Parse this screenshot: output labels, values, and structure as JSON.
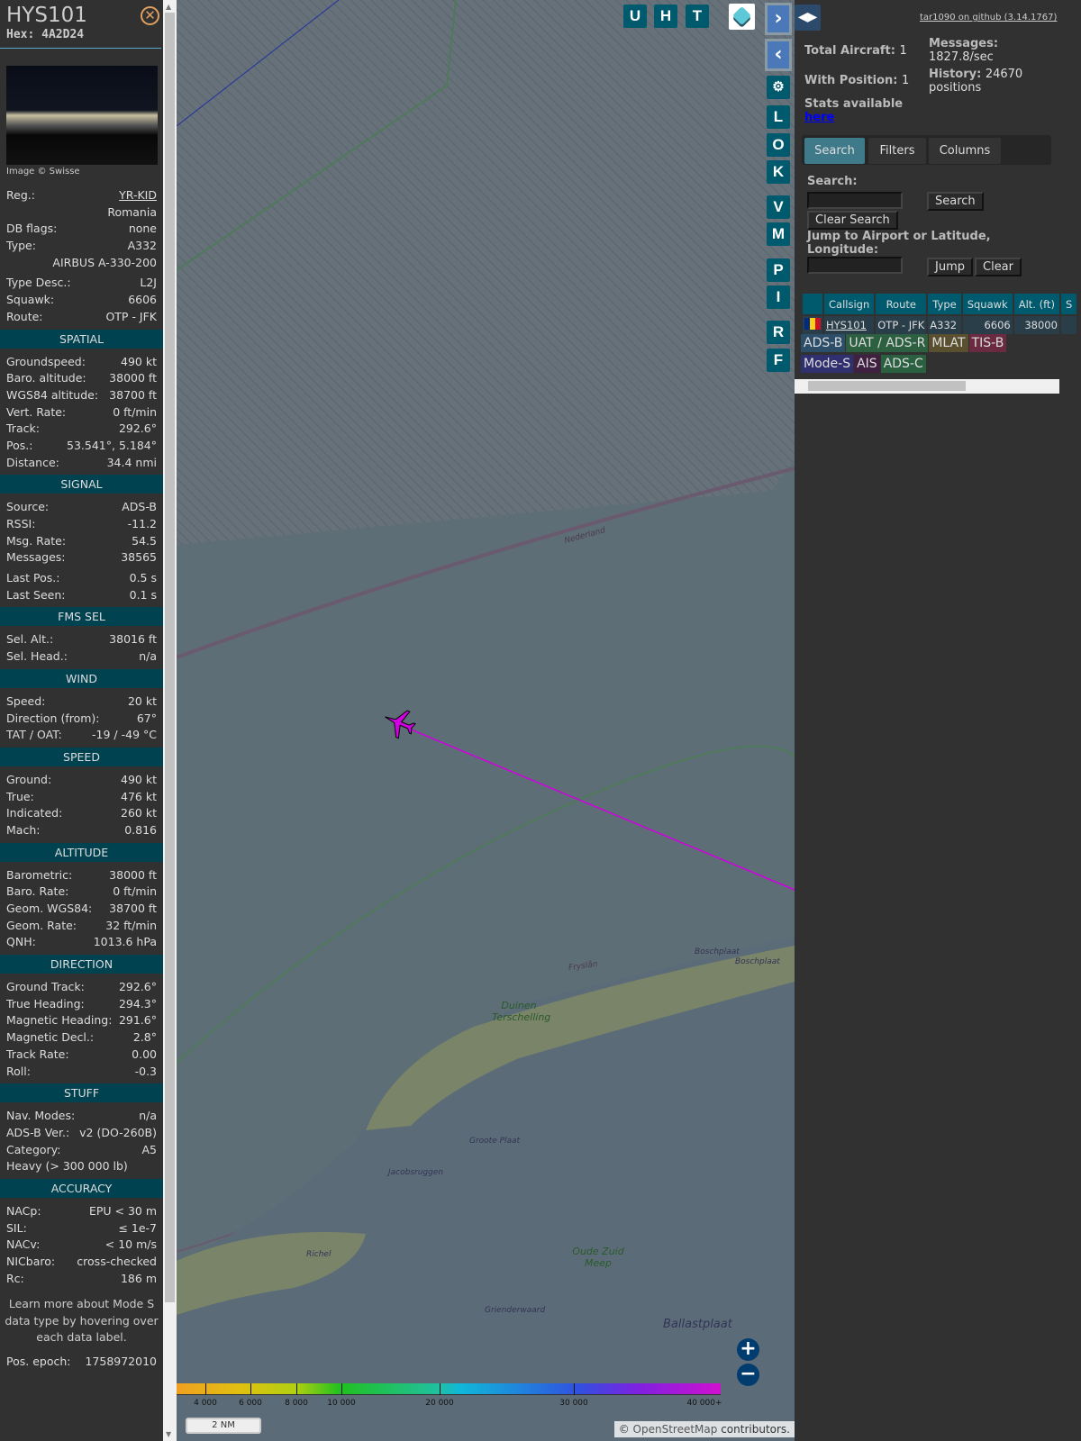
{
  "aircraft": {
    "callsign": "HYS101",
    "hex": "Hex: 4A2D24",
    "image_caption": "Image © Swisse"
  },
  "info_rows": [
    {
      "label": "Reg.:",
      "value": "YR-KID",
      "link": true
    },
    {
      "label": "",
      "value": "Romania"
    },
    {
      "label": "DB flags:",
      "value": "none"
    },
    {
      "label": "Type:",
      "value": "A332"
    },
    {
      "label": "",
      "value": "AIRBUS A-330-200"
    },
    {
      "label": "Type Desc.:",
      "value": "L2J",
      "gap": true
    },
    {
      "label": "Squawk:",
      "value": "6606"
    },
    {
      "label": "Route:",
      "value": "OTP - JFK"
    }
  ],
  "sections": [
    {
      "title": "SPATIAL",
      "rows": [
        [
          "Groundspeed:",
          "490 kt"
        ],
        [
          "Baro. altitude:",
          "38000 ft"
        ],
        [
          "WGS84 altitude:",
          "38700 ft"
        ],
        [
          "Vert. Rate:",
          "0 ft/min"
        ],
        [
          "Track:",
          "292.6°"
        ],
        [
          "Pos.:",
          "53.541°, 5.184°"
        ],
        [
          "Distance:",
          "34.4 nmi"
        ]
      ]
    },
    {
      "title": "SIGNAL",
      "rows": [
        [
          "Source:",
          "ADS-B"
        ],
        [
          "RSSI:",
          "-11.2"
        ],
        [
          "Msg. Rate:",
          "54.5"
        ],
        [
          "Messages:",
          "38565"
        ],
        [
          "Last Pos.:",
          "0.5 s",
          true
        ],
        [
          "Last Seen:",
          "0.1 s"
        ]
      ]
    },
    {
      "title": "FMS SEL",
      "rows": [
        [
          "Sel. Alt.:",
          "38016 ft"
        ],
        [
          "Sel. Head.:",
          "n/a"
        ]
      ]
    },
    {
      "title": "WIND",
      "rows": [
        [
          "Speed:",
          "20 kt"
        ],
        [
          "Direction (from):",
          "67°"
        ],
        [
          "TAT / OAT:",
          "-19 / -49 °C"
        ]
      ]
    },
    {
      "title": "SPEED",
      "rows": [
        [
          "Ground:",
          "490 kt"
        ],
        [
          "True:",
          "476 kt"
        ],
        [
          "Indicated:",
          "260 kt"
        ],
        [
          "Mach:",
          "0.816"
        ]
      ]
    },
    {
      "title": "ALTITUDE",
      "rows": [
        [
          "Barometric:",
          "38000 ft"
        ],
        [
          "Baro. Rate:",
          "0 ft/min"
        ],
        [
          "Geom. WGS84:",
          "38700 ft"
        ],
        [
          "Geom. Rate:",
          "32 ft/min"
        ],
        [
          "QNH:",
          "1013.6 hPa"
        ]
      ]
    },
    {
      "title": "DIRECTION",
      "rows": [
        [
          "Ground Track:",
          "292.6°"
        ],
        [
          "True Heading:",
          "294.3°"
        ],
        [
          "Magnetic Heading:",
          "291.6°"
        ],
        [
          "Magnetic Decl.:",
          "2.8°"
        ],
        [
          "Track Rate:",
          "0.00"
        ],
        [
          "Roll:",
          "-0.3"
        ]
      ]
    },
    {
      "title": "STUFF",
      "rows": [
        [
          "Nav. Modes:",
          "n/a"
        ],
        [
          "ADS-B Ver.:",
          "v2 (DO-260B)"
        ],
        [
          "Category:",
          "A5"
        ],
        [
          "Heavy (> 300 000 lb)",
          ""
        ]
      ]
    },
    {
      "title": "ACCURACY",
      "rows": [
        [
          "NACp:",
          "EPU < 30 m"
        ],
        [
          "SIL:",
          "≤ 1e-7"
        ],
        [
          "NACv:",
          "< 10 m/s"
        ],
        [
          "NICbaro:",
          "cross-checked"
        ],
        [
          "Rc:",
          "186 m"
        ]
      ]
    }
  ],
  "note": "Learn more about Mode S data type by hovering over each data label.",
  "pos_epoch": {
    "label": "Pos. epoch:",
    "value": "1758972010"
  },
  "map": {
    "top_buttons": [
      "U",
      "H",
      "T"
    ],
    "side_buttons": [
      "L",
      "O",
      "K",
      "V",
      "M",
      "P",
      "I",
      "R",
      "F"
    ],
    "labels": [
      "Nederland",
      "Fryslân",
      "Duinen Terschelling",
      "Boschplaat",
      "Boschplaat",
      "Groote Plaat",
      "Jacobsruggen",
      "Richel",
      "Oude Zuid Meep",
      "Grienderwaard",
      "Ballastplaat"
    ],
    "color_scale_ticks": [
      "4 000",
      "6 000",
      "8 000",
      "10 000",
      "20 000",
      "30 000",
      "40 000+"
    ],
    "scale_bar": "2 NM",
    "attribution_prefix": "© ",
    "attribution_link": "OpenStreetMap",
    "attribution_suffix": " contributors.",
    "track_color": "#d000e0"
  },
  "panel": {
    "github": "tar1090 on github (3.14.1767)",
    "total_label": "Total Aircraft:",
    "total": "1",
    "pos_label": "With Position:",
    "pos": "1",
    "msg_label": "Messages:",
    "msg": "1827.8/sec",
    "hist_label": "History:",
    "hist": "24670 positions",
    "stats_label": "Stats available",
    "stats_link": "here",
    "tabs": [
      "Search",
      "Filters",
      "Columns"
    ],
    "search_label": "Search:",
    "search_btn": "Search",
    "clear_search_btn": "Clear Search",
    "jump_label": "Jump to Airport or Latitude, Longitude:",
    "jump_btn": "Jump",
    "clear_btn": "Clear",
    "table_headers": [
      "",
      "Callsign",
      "Route",
      "Type",
      "Squawk",
      "Alt. (ft)",
      "S"
    ],
    "table_rows": [
      {
        "callsign": "HYS101",
        "route": "OTP - JFK",
        "type": "A332",
        "squawk": "6606",
        "alt": "38000"
      }
    ],
    "legend": [
      {
        "t": "ADS-B",
        "c": "#2c4e68"
      },
      {
        "t": "UAT / ADS-R",
        "c": "#2d6040"
      },
      {
        "t": "MLAT",
        "c": "#5a5030"
      },
      {
        "t": "TIS-B",
        "c": "#6a2a40"
      },
      {
        "t": "Mode-S",
        "c": "#303070"
      },
      {
        "t": "AIS",
        "c": "#402040"
      },
      {
        "t": "ADS-C",
        "c": "#2a6040"
      }
    ]
  }
}
